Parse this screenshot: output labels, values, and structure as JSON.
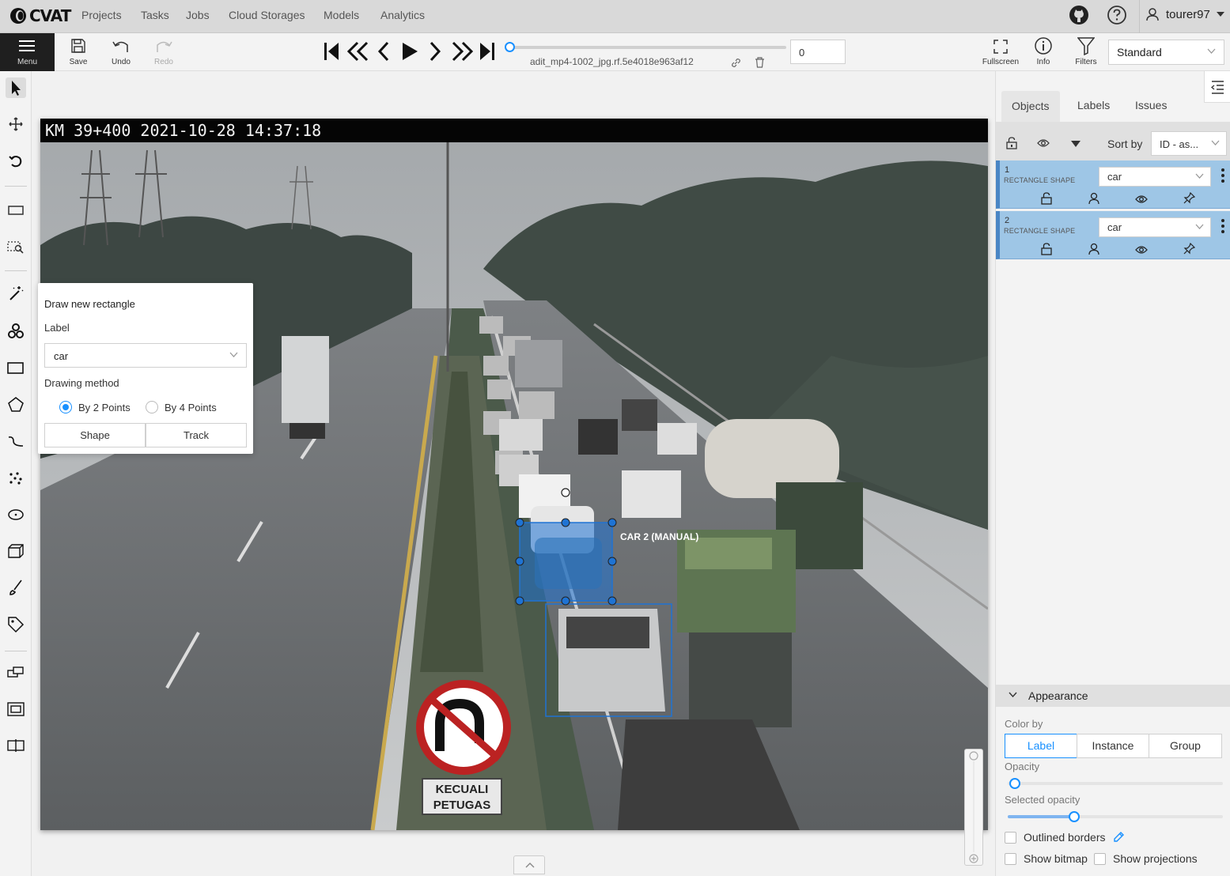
{
  "app": {
    "logo_text": "CVAT"
  },
  "nav": {
    "items": [
      {
        "label": "Projects"
      },
      {
        "label": "Tasks"
      },
      {
        "label": "Jobs"
      },
      {
        "label": "Cloud Storages"
      },
      {
        "label": "Models"
      },
      {
        "label": "Analytics"
      }
    ]
  },
  "user": {
    "name": "tourer97"
  },
  "toolbar": {
    "menu_label": "Menu",
    "save_label": "Save",
    "undo_label": "Undo",
    "redo_label": "Redo",
    "frame_name": "adit_mp4-1002_jpg.rf.5e4018e963af12",
    "frame_number": "0",
    "frame_progress": 0.0,
    "fullscreen_label": "Fullscreen",
    "info_label": "Info",
    "filters_label": "Filters",
    "workspace": "Standard"
  },
  "image": {
    "timestamp_overlay": "KM 39+400  2021-10-28 14:37:18",
    "sign_text": "KECUALI PETUGAS",
    "shape_label": "CAR 2 (MANUAL)",
    "shape_color": "#1f73d3"
  },
  "draw_popover": {
    "title": "Draw new rectangle",
    "label_heading": "Label",
    "label_value": "car",
    "method_heading": "Drawing method",
    "method_1": "By 2 Points",
    "method_2": "By 4 Points",
    "method_selected": "By 2 Points",
    "shape_button": "Shape",
    "track_button": "Track"
  },
  "sidebar": {
    "tabs": [
      {
        "label": "Objects"
      },
      {
        "label": "Labels"
      },
      {
        "label": "Issues"
      }
    ],
    "active_tab": "Objects",
    "sort_by_label": "Sort by",
    "sort_value": "ID - as...",
    "objects": [
      {
        "id": "1",
        "type": "RECTANGLE SHAPE",
        "label": "car"
      },
      {
        "id": "2",
        "type": "RECTANGLE SHAPE",
        "label": "car"
      }
    ],
    "object_color": "#9ec6e6"
  },
  "appearance": {
    "title": "Appearance",
    "color_by_label": "Color by",
    "color_by_options": [
      "Label",
      "Instance",
      "Group"
    ],
    "color_by_selected": "Label",
    "opacity_label": "Opacity",
    "opacity_value": 0.0,
    "selected_opacity_label": "Selected opacity",
    "selected_opacity_value": 0.3,
    "outlined_borders_label": "Outlined borders",
    "show_bitmap_label": "Show bitmap",
    "show_projections_label": "Show projections"
  }
}
